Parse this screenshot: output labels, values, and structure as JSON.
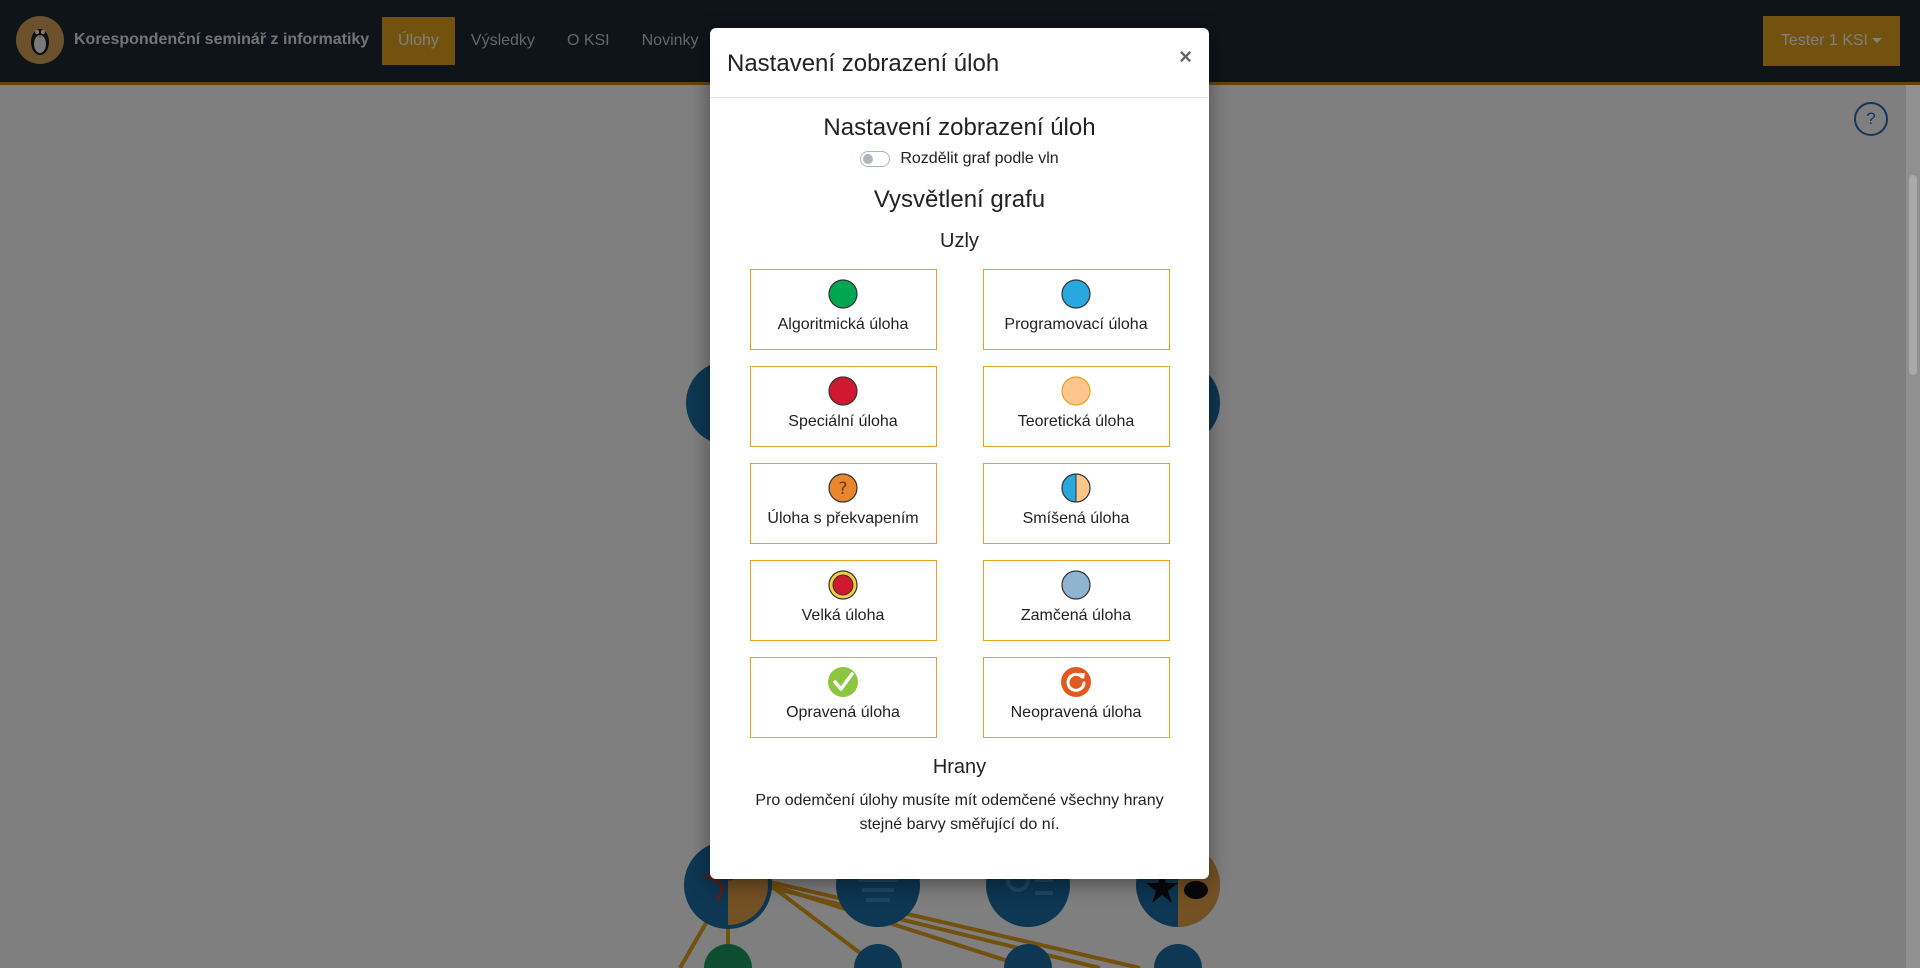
{
  "brand": {
    "name": "Korespondenční seminář z informatiky"
  },
  "nav": [
    {
      "label": "Úlohy",
      "active": true
    },
    {
      "label": "Výsledky",
      "active": false
    },
    {
      "label": "O KSI",
      "active": false
    },
    {
      "label": "Novinky",
      "active": false
    }
  ],
  "user": {
    "label": "Tester 1 KSI"
  },
  "help": {
    "label": "?"
  },
  "modal": {
    "title": "Nastavení zobrazení úloh",
    "close": "×",
    "heading": "Nastavení zobrazení úloh",
    "toggle_label": "Rozdělit graf podle vln",
    "toggle_on": false,
    "legend_heading": "Vysvětlení grafu",
    "nodes_heading": "Uzly",
    "nodes": [
      {
        "label": "Algoritmická úloha",
        "icon": "green-circle-icon",
        "color": "#00a651"
      },
      {
        "label": "Programovací úloha",
        "icon": "blue-circle-icon",
        "color": "#29a8e0"
      },
      {
        "label": "Speciální úloha",
        "icon": "red-circle-icon",
        "color": "#d0182f"
      },
      {
        "label": "Teoretická úloha",
        "icon": "peach-circle-icon",
        "color": "#fdc68c"
      },
      {
        "label": "Úloha s překvapením",
        "icon": "question-circle-icon",
        "color": "#e8872e"
      },
      {
        "label": "Smíšená úloha",
        "icon": "half-circle-icon",
        "color": "#29a8e0"
      },
      {
        "label": "Velká úloha",
        "icon": "big-task-circle-icon",
        "color": "#d0182f"
      },
      {
        "label": "Zamčená úloha",
        "icon": "locked-circle-icon",
        "color": "#8fb4d0"
      },
      {
        "label": "Opravená úloha",
        "icon": "checkmark-circle-icon",
        "color": "#8cc63f"
      },
      {
        "label": "Neopravená úloha",
        "icon": "refresh-circle-icon",
        "color": "#e05a1f"
      }
    ],
    "edges_heading": "Hrany",
    "edges_desc": "Pro odemčení úlohy musíte mít odemčené všechny hrany stejné barvy směřující do ní."
  }
}
